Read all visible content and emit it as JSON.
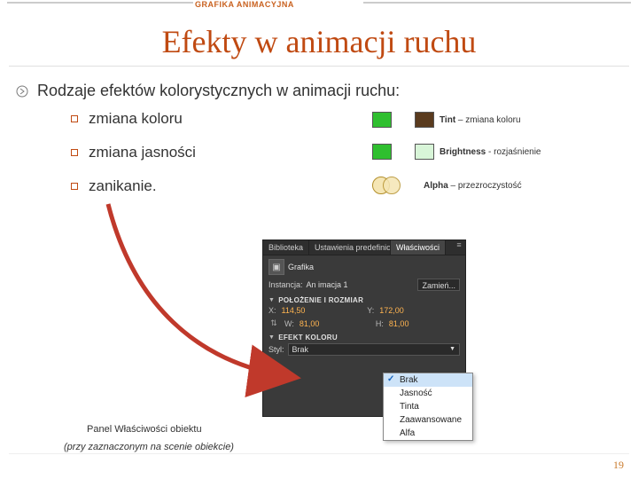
{
  "header_tag": "GRAFIKA ANIMACYJNA",
  "title": "Efekty w animacji ruchu",
  "intro": "Rodzaje efektów kolorystycznych w animacji ruchu:",
  "bullets": [
    "zmiana koloru",
    "zmiana jasności",
    "zanikanie."
  ],
  "samples": [
    {
      "swatch_a": "#2fbf2f",
      "swatch_b": "#5a3b1e",
      "label_bold": "Tint",
      "label_rest": " – zmiana koloru"
    },
    {
      "swatch_a": "#2fbf2f",
      "swatch_b": "#d8f5d8",
      "label_bold": "Brightness",
      "label_rest": " - rozjaśnienie"
    },
    {
      "type": "alpha",
      "label_bold": "Alpha",
      "label_rest": " – przezroczystość"
    }
  ],
  "panel": {
    "tabs": {
      "a": "Biblioteka",
      "b": "Ustawienia predefiniowane re",
      "c": "Właściwości"
    },
    "kind": "Grafika",
    "instance_label": "Instancja:",
    "instance_value": "An imacja 1",
    "swap_btn": "Zamień...",
    "sect_pos": "POŁOŻENIE I ROZMIAR",
    "x_k": "X:",
    "x_v": "114,50",
    "y_k": "Y:",
    "y_v": "172,00",
    "w_k": "W:",
    "w_v": "81,00",
    "h_k": "H:",
    "h_v": "81,00",
    "sect_fx": "EFEKT KOLORU",
    "style_k": "Styl:",
    "style_v": "Brak"
  },
  "dropdown": [
    "Brak",
    "Jasność",
    "Tinta",
    "Zaawansowane",
    "Alfa"
  ],
  "dropdown_selected": 0,
  "caption1": "Panel Właściwości obiektu",
  "caption2": "(przy zaznaczonym na scenie obiekcie)",
  "page": "19"
}
